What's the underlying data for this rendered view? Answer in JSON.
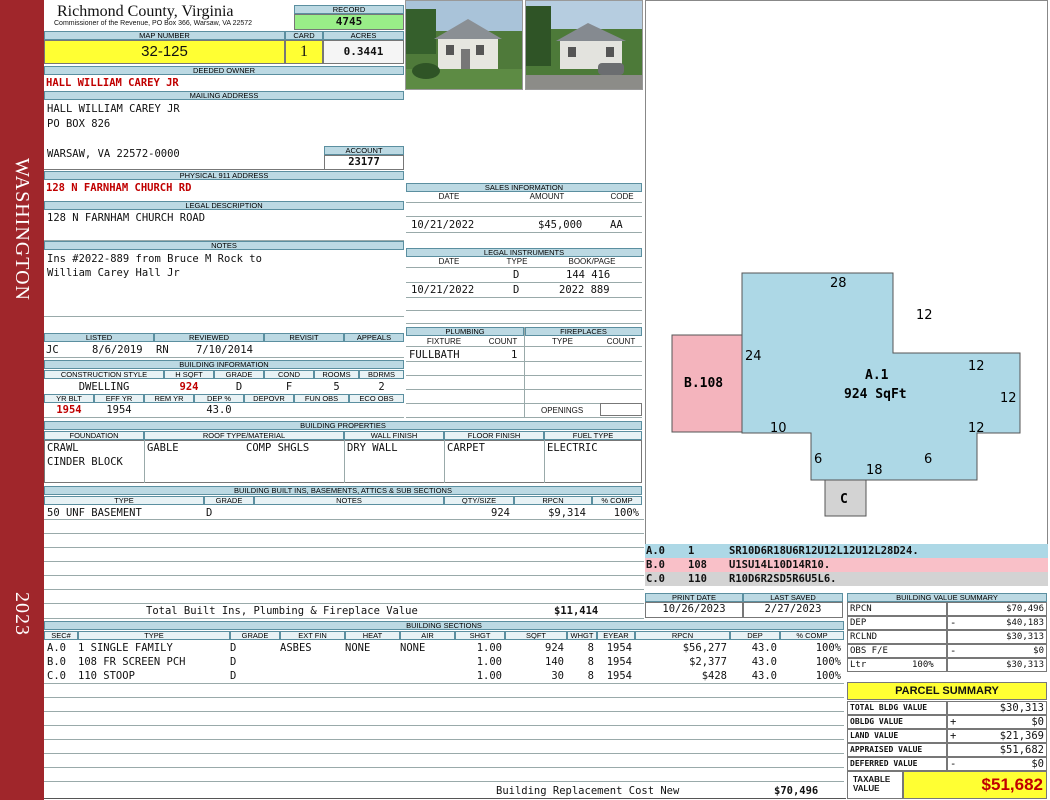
{
  "sidebar": {
    "district": "WASHINGTON",
    "year": "2023"
  },
  "header": {
    "county": "Richmond County, Virginia",
    "commissioner": "Commissioner of the Revenue, PO Box 366, Warsaw, VA 22572",
    "record_label": "RECORD",
    "record": "4745",
    "map_label": "MAP NUMBER",
    "map_number": "32-125",
    "card_label": "CARD",
    "card": "1",
    "acres_label": "ACRES",
    "acres": "0.3441"
  },
  "owner": {
    "deeded_label": "DEEDED OWNER",
    "deeded": "HALL WILLIAM CAREY JR",
    "mailing_label": "MAILING ADDRESS",
    "mailing": [
      "HALL WILLIAM CAREY JR",
      "PO BOX 826",
      "",
      "WARSAW, VA 22572-0000"
    ],
    "account_label": "ACCOUNT",
    "account": "23177",
    "physical_label": "PHYSICAL 911 ADDRESS",
    "physical": "128 N FARNHAM CHURCH RD",
    "legal_label": "LEGAL DESCRIPTION",
    "legal": "128 N FARNHAM CHURCH ROAD",
    "notes_label": "NOTES",
    "notes": [
      "Ins #2022-889 from Bruce M Rock to",
      "William Carey Hall Jr"
    ]
  },
  "sales": {
    "title": "SALES INFORMATION",
    "headers": [
      "DATE",
      "AMOUNT",
      "CODE"
    ],
    "rows": [
      {
        "date": "10/21/2022",
        "amount": "$45,000",
        "code": "AA"
      }
    ]
  },
  "legal_instruments": {
    "title": "LEGAL INSTRUMENTS",
    "headers": [
      "DATE",
      "TYPE",
      "BOOK/PAGE"
    ],
    "rows": [
      {
        "date": "",
        "type": "D",
        "book": "144 416"
      },
      {
        "date": "10/21/2022",
        "type": "D",
        "book": "2022 889"
      }
    ]
  },
  "review": {
    "headers": [
      "LISTED",
      "REVIEWED",
      "REVISIT",
      "APPEALS"
    ],
    "listed_by": "JC",
    "listed": "8/6/2019",
    "reviewed_by": "RN",
    "reviewed": "7/10/2014"
  },
  "building_info": {
    "title": "BUILDING INFORMATION",
    "headers": [
      "CONSTRUCTION STYLE",
      "H SQFT",
      "GRADE",
      "COND",
      "ROOMS",
      "BDRMS"
    ],
    "values": [
      "DWELLING",
      "924",
      "D",
      "F",
      "5",
      "2"
    ],
    "headers2": [
      "YR BLT",
      "EFF YR",
      "REM YR",
      "DEP %",
      "DEPOVR",
      "FUN OBS",
      "ECO OBS"
    ],
    "values2": [
      "1954",
      "1954",
      "",
      "43.0",
      "",
      "",
      ""
    ]
  },
  "plumbing": {
    "title": "PLUMBING",
    "headers": [
      "FIXTURE",
      "COUNT"
    ],
    "rows": [
      {
        "fixture": "FULLBATH",
        "count": "1"
      }
    ]
  },
  "fireplaces": {
    "title": "FIREPLACES",
    "headers": [
      "TYPE",
      "COUNT"
    ],
    "openings": "OPENINGS"
  },
  "properties": {
    "title": "BUILDING PROPERTIES",
    "headers": [
      "FOUNDATION",
      "ROOF TYPE/MATERIAL",
      "WALL FINISH",
      "FLOOR FINISH",
      "FUEL TYPE"
    ],
    "foundation": [
      "CRAWL",
      "CINDER BLOCK"
    ],
    "roof_type": "GABLE",
    "roof_material": "COMP SHGLS",
    "wall": "DRY WALL",
    "floor": "CARPET",
    "fuel": "ELECTRIC"
  },
  "builtins": {
    "title": "BUILDING BUILT INS, BASEMENTS, ATTICS & SUB SECTIONS",
    "headers": [
      "TYPE",
      "GRADE",
      "NOTES",
      "QTY/SIZE",
      "RPCN",
      "% COMP"
    ],
    "rows": [
      {
        "type": "50 UNF BASEMENT",
        "grade": "D",
        "notes": "",
        "qty": "924",
        "rpcn": "$9,314",
        "comp": "100%"
      }
    ],
    "total_label": "Total Built Ins, Plumbing & Fireplace Value",
    "total": "$11,414"
  },
  "sketch": {
    "main_label": "A.1",
    "main_area": "924 SqFt",
    "b_label": "B.108",
    "c_label": "C",
    "dims": [
      "28",
      "12",
      "24",
      "12",
      "12",
      "12",
      "10",
      "6",
      "18",
      "6"
    ],
    "colors": {
      "main": "#add8e6",
      "b": "#f4b4bd",
      "c": "#d3d3d3"
    },
    "legend": [
      {
        "sec": "A.0",
        "code": "1",
        "vec": "SR10D6R18U6R12U12L12U12L28D24."
      },
      {
        "sec": "B.0",
        "code": "108",
        "vec": "U1SU14L10D14R10."
      },
      {
        "sec": "C.0",
        "code": "110",
        "vec": "R10D6R2SD5R6U5L6."
      }
    ]
  },
  "dates": {
    "print_label": "PRINT DATE",
    "print": "10/26/2023",
    "saved_label": "LAST SAVED",
    "saved": "2/27/2023"
  },
  "sections": {
    "title": "BUILDING SECTIONS",
    "headers": [
      "SEC#",
      "TYPE",
      "GRADE",
      "EXT FIN",
      "HEAT",
      "AIR",
      "SHGT",
      "SQFT",
      "WHGT",
      "EYEAR",
      "RPCN",
      "DEP",
      "% COMP"
    ],
    "rows": [
      [
        "A.0",
        "1 SINGLE FAMILY",
        "D",
        "ASBES",
        "NONE",
        "NONE",
        "1.00",
        "924",
        "8",
        "1954",
        "$56,277",
        "43.0",
        "100%"
      ],
      [
        "B.0",
        "108 FR SCREEN PCH",
        "D",
        "",
        "",
        "",
        "1.00",
        "140",
        "8",
        "1954",
        "$2,377",
        "43.0",
        "100%"
      ],
      [
        "C.0",
        "110 STOOP",
        "D",
        "",
        "",
        "",
        "1.00",
        "30",
        "8",
        "1954",
        "$428",
        "43.0",
        "100%"
      ]
    ],
    "replacement_label": "Building Replacement Cost New",
    "replacement": "$70,496"
  },
  "value_summary": {
    "title": "BUILDING VALUE SUMMARY",
    "rows": [
      {
        "label": "RPCN",
        "sign": "",
        "value": "$70,496"
      },
      {
        "label": "DEP",
        "sign": "-",
        "value": "$40,183"
      },
      {
        "label": "RCLND",
        "sign": "",
        "value": "$30,313"
      },
      {
        "label": "OBS F/E",
        "sign": "-",
        "value": "$0"
      },
      {
        "label": "Ltr",
        "pct": "100%",
        "sign": "",
        "value": "$30,313"
      }
    ]
  },
  "parcel": {
    "title": "PARCEL SUMMARY",
    "rows": [
      {
        "label": "TOTAL BLDG VALUE",
        "sign": "",
        "value": "$30,313"
      },
      {
        "label": "OBLDG VALUE",
        "sign": "+",
        "value": "$0"
      },
      {
        "label": "LAND VALUE",
        "sign": "+",
        "value": "$21,369"
      },
      {
        "label": "APPRAISED VALUE",
        "sign": "",
        "value": "$51,682"
      },
      {
        "label": "DEFERRED VALUE",
        "sign": "-",
        "value": "$0"
      }
    ],
    "taxable_label": "TAXABLE VALUE",
    "taxable": "$51,682"
  },
  "style": {
    "accent": "#a0262b",
    "header_fill": "#bcd9e3",
    "yellow": "#ffff33",
    "green": "#99ee88"
  }
}
